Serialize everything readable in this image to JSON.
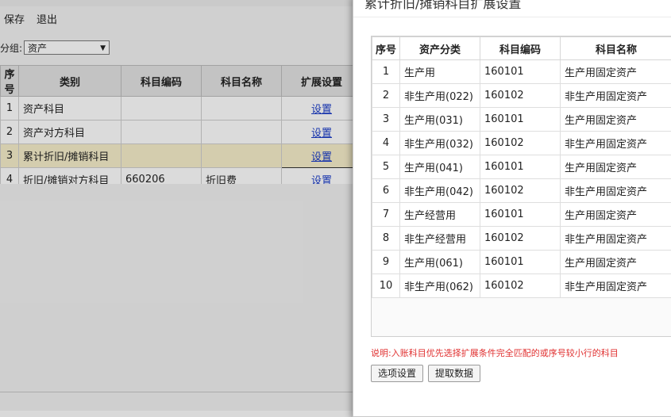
{
  "background": {
    "toolbar": {
      "save": "保存",
      "exit": "退出"
    },
    "group": {
      "label": "分组:",
      "value": "资产"
    },
    "table": {
      "headers": [
        "序号",
        "类别",
        "科目编码",
        "科目名称",
        "扩展设置"
      ],
      "rows": [
        {
          "no": "1",
          "category": "资产科目",
          "code": "",
          "name": "",
          "action": "设置"
        },
        {
          "no": "2",
          "category": "资产对方科目",
          "code": "",
          "name": "",
          "action": "设置"
        },
        {
          "no": "3",
          "category": "累计折旧/摊销科目",
          "code": "",
          "name": "",
          "action": "设置"
        },
        {
          "no": "4",
          "category": "折旧/摊销对方科目",
          "code": "660206",
          "name": "折旧费",
          "action": "设置"
        }
      ]
    }
  },
  "dialog": {
    "title": "累计折旧/摊销科目扩展设置",
    "headers": [
      "序号",
      "资产分类",
      "科目编码",
      "科目名称"
    ],
    "rows": [
      {
        "no": "1",
        "category": "生产用",
        "code": "160101",
        "name": "生产用固定资产"
      },
      {
        "no": "2",
        "category": "非生产用(022)",
        "code": "160102",
        "name": "非生产用固定资产"
      },
      {
        "no": "3",
        "category": "生产用(031)",
        "code": "160101",
        "name": "生产用固定资产"
      },
      {
        "no": "4",
        "category": "非生产用(032)",
        "code": "160102",
        "name": "非生产用固定资产"
      },
      {
        "no": "5",
        "category": "生产用(041)",
        "code": "160101",
        "name": "生产用固定资产"
      },
      {
        "no": "6",
        "category": "非生产用(042)",
        "code": "160102",
        "name": "非生产用固定资产"
      },
      {
        "no": "7",
        "category": "生产经营用",
        "code": "160101",
        "name": "生产用固定资产"
      },
      {
        "no": "8",
        "category": "非生产经营用",
        "code": "160102",
        "name": "非生产用固定资产"
      },
      {
        "no": "9",
        "category": "生产用(061)",
        "code": "160101",
        "name": "生产用固定资产"
      },
      {
        "no": "10",
        "category": "非生产用(062)",
        "code": "160102",
        "name": "非生产用固定资产"
      }
    ],
    "note": "说明:入账科目优先选择扩展条件完全匹配的或序号较小行的科目",
    "buttons": {
      "options": "选项设置",
      "fetch": "提取数据"
    }
  },
  "colors": {
    "selected_row": "#f7efcb",
    "link": "#1a3cc9",
    "note": "#e03030"
  }
}
